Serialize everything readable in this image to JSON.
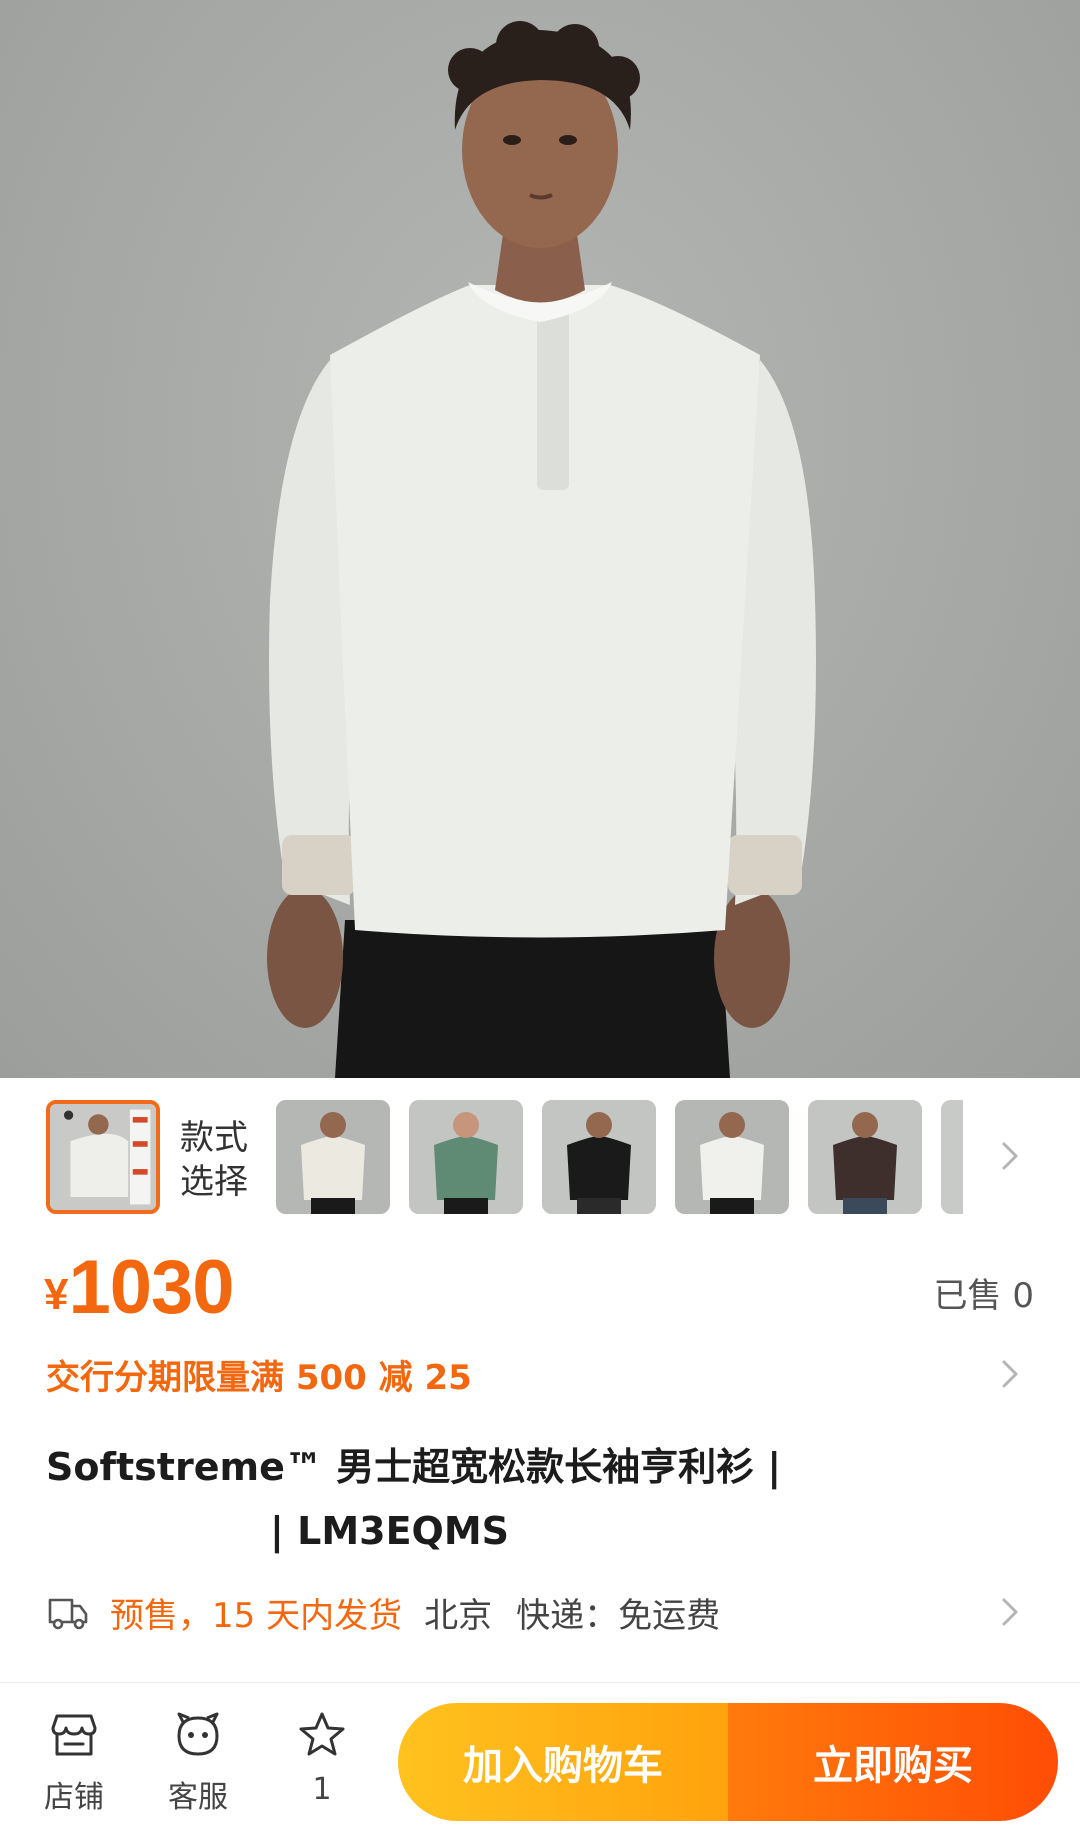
{
  "product": {
    "hero_image": "man-wearing-white-henley-longsleeve"
  },
  "variants": {
    "label": "款式\n选择",
    "thumbnails": [
      {
        "name": "variant-1",
        "shirt": "#eeeeea",
        "selected": true
      },
      {
        "name": "variant-2",
        "shirt": "#ece9e0"
      },
      {
        "name": "variant-3",
        "shirt": "#5f8a74"
      },
      {
        "name": "variant-4",
        "shirt": "#1a1a1a"
      },
      {
        "name": "variant-5",
        "shirt": "#f0f0ec"
      },
      {
        "name": "variant-6",
        "shirt": "#3e2e2c"
      }
    ]
  },
  "price": {
    "currency": "¥",
    "amount": "1030",
    "sold_label": "已售 0"
  },
  "promo": {
    "text": "交行分期限量满 500 减 25"
  },
  "title": {
    "line1": "Softstreme™ 男士超宽松款长袖亨利衫 |",
    "line2": "| LM3EQMS"
  },
  "shipping": {
    "presale": "预售，15 天内发货",
    "location": "北京",
    "delivery": "快递：免运费"
  },
  "bottom_bar": {
    "store_label": "店铺",
    "service_label": "客服",
    "favorite_count": "1",
    "add_to_cart": "加入购物车",
    "buy_now": "立即购买"
  },
  "colors": {
    "accent": "#f3670f",
    "cart_button": "#ffb414",
    "buy_button": "#ff5a06"
  }
}
